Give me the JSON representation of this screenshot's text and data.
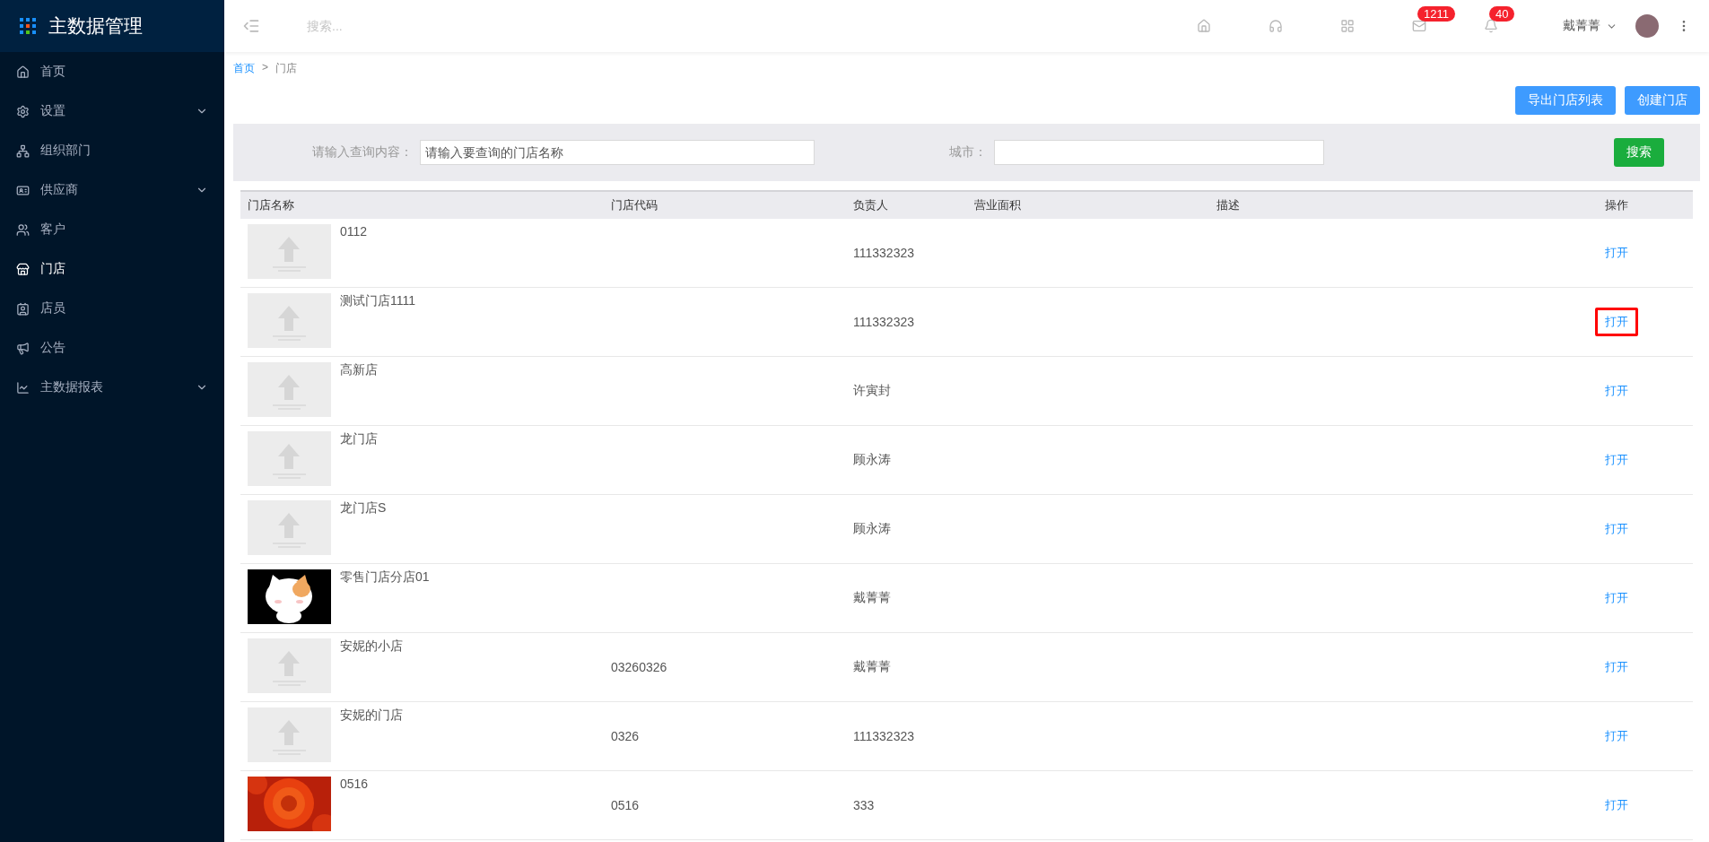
{
  "app": {
    "title": "主数据管理"
  },
  "sidebar": {
    "items": [
      {
        "label": "首页",
        "selected": false
      },
      {
        "label": "设置",
        "selected": false,
        "expandable": true
      },
      {
        "label": "组织部门",
        "selected": false
      },
      {
        "label": "供应商",
        "selected": false,
        "expandable": true
      },
      {
        "label": "客户",
        "selected": false
      },
      {
        "label": "门店",
        "selected": true
      },
      {
        "label": "店员",
        "selected": false
      },
      {
        "label": "公告",
        "selected": false
      },
      {
        "label": "主数据报表",
        "selected": false,
        "expandable": true
      }
    ]
  },
  "topbar": {
    "search": {
      "placeholder": "搜索..."
    },
    "badges": [
      {
        "count": "1211"
      },
      {
        "count": "40"
      }
    ],
    "user": {
      "name": "戴菁菁"
    }
  },
  "breadcrumb": [
    {
      "label": "首页",
      "link": true
    },
    {
      "label": ">",
      "link": false
    },
    {
      "label": "门店",
      "link": false
    }
  ],
  "actions": [
    "导出门店列表",
    "创建门店"
  ],
  "filter": {
    "query_label": "请输入查询内容：",
    "query_placeholder": "请输入要查询的门店名称",
    "city_label": "城市：",
    "search_button": "搜索"
  },
  "table": {
    "columns": [
      "门店名称",
      "门店代码",
      "负责人",
      "营业面积",
      "描述",
      "操作"
    ],
    "rows": [
      {
        "kind": "placeholder",
        "name": "0112",
        "owner": "111332323",
        "action": "打开",
        "highlighted": false
      },
      {
        "kind": "placeholder",
        "name": "测试门店1111",
        "owner": "111332323",
        "action": "打开",
        "highlighted": true
      },
      {
        "kind": "placeholder",
        "name": "高新店",
        "owner": "许寅封",
        "action": "打开",
        "highlighted": false
      },
      {
        "kind": "placeholder",
        "name": "龙门店",
        "owner": "顾永涛",
        "action": "打开",
        "highlighted": false
      },
      {
        "kind": "placeholder",
        "name": "龙门店S",
        "owner": "顾永涛",
        "action": "打开",
        "highlighted": false
      },
      {
        "kind": "picture",
        "name": "零售门店分店01",
        "owner": "戴菁菁",
        "action": "打开",
        "highlighted": false
      },
      {
        "kind": "placeholder",
        "name": "安妮的小店",
        "code": "03260326",
        "owner": "戴菁菁",
        "action": "打开",
        "highlighted": false
      },
      {
        "kind": "placeholder",
        "name": "安妮的门店",
        "code": "0326",
        "owner": "111332323",
        "action": "打开",
        "highlighted": false
      },
      {
        "kind": "picture",
        "name": "0516",
        "code": "0516",
        "owner": "333",
        "action": "打开",
        "highlighted": false
      }
    ]
  }
}
